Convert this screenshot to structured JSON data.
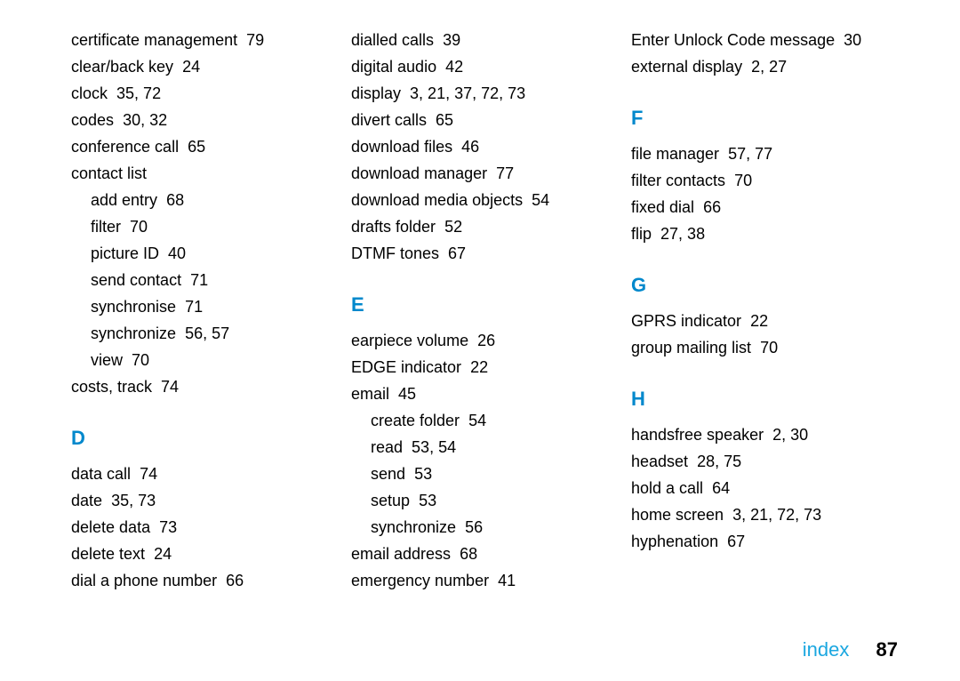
{
  "footer": {
    "label": "index",
    "page": "87"
  },
  "headings": {
    "D": "D",
    "E": "E",
    "F": "F",
    "G": "G",
    "H": "H"
  },
  "col1_top": [
    {
      "term": "certificate management",
      "pages": "79"
    },
    {
      "term": "clear/back key",
      "pages": "24"
    },
    {
      "term": "clock",
      "pages": "35, 72"
    },
    {
      "term": "codes",
      "pages": "30, 32"
    },
    {
      "term": "conference call",
      "pages": "65"
    },
    {
      "term": "contact list",
      "pages": ""
    },
    {
      "term": "add entry",
      "pages": "68",
      "sub": true
    },
    {
      "term": "filter",
      "pages": "70",
      "sub": true
    },
    {
      "term": "picture ID",
      "pages": "40",
      "sub": true
    },
    {
      "term": "send contact",
      "pages": "71",
      "sub": true
    },
    {
      "term": "synchronise",
      "pages": "71",
      "sub": true
    },
    {
      "term": "synchronize",
      "pages": "56, 57",
      "sub": true
    },
    {
      "term": "view",
      "pages": "70",
      "sub": true
    },
    {
      "term": "costs, track",
      "pages": "74"
    }
  ],
  "col1_D": [
    {
      "term": "data call",
      "pages": "74"
    },
    {
      "term": "date",
      "pages": "35, 73"
    },
    {
      "term": "delete data",
      "pages": "73"
    },
    {
      "term": "delete text",
      "pages": "24"
    },
    {
      "term": "dial a phone number",
      "pages": "66"
    }
  ],
  "col2_top": [
    {
      "term": "dialled calls",
      "pages": "39"
    },
    {
      "term": "digital audio",
      "pages": "42"
    },
    {
      "term": "display",
      "pages": "3, 21, 37, 72, 73"
    },
    {
      "term": "divert calls",
      "pages": "65"
    },
    {
      "term": "download files",
      "pages": "46"
    },
    {
      "term": "download manager",
      "pages": "77"
    },
    {
      "term": "download media objects",
      "pages": "54"
    },
    {
      "term": "drafts folder",
      "pages": "52"
    },
    {
      "term": "DTMF tones",
      "pages": "67"
    }
  ],
  "col2_E": [
    {
      "term": "earpiece volume",
      "pages": "26"
    },
    {
      "term": "EDGE indicator",
      "pages": "22"
    },
    {
      "term": "email",
      "pages": "45"
    },
    {
      "term": "create folder",
      "pages": "54",
      "sub": true
    },
    {
      "term": "read",
      "pages": "53, 54",
      "sub": true
    },
    {
      "term": "send",
      "pages": "53",
      "sub": true
    },
    {
      "term": "setup",
      "pages": "53",
      "sub": true
    },
    {
      "term": "synchronize",
      "pages": "56",
      "sub": true
    },
    {
      "term": "email address",
      "pages": "68"
    },
    {
      "term": "emergency number",
      "pages": "41"
    }
  ],
  "col3_top": [
    {
      "term": "Enter Unlock Code message",
      "pages": "30"
    },
    {
      "term": "external display",
      "pages": "2, 27"
    }
  ],
  "col3_F": [
    {
      "term": "file manager",
      "pages": "57, 77"
    },
    {
      "term": "filter contacts",
      "pages": "70"
    },
    {
      "term": "fixed dial",
      "pages": "66"
    },
    {
      "term": "flip",
      "pages": "27, 38"
    }
  ],
  "col3_G": [
    {
      "term": "GPRS indicator",
      "pages": "22"
    },
    {
      "term": "group mailing list",
      "pages": "70"
    }
  ],
  "col3_H": [
    {
      "term": "handsfree speaker",
      "pages": "2, 30"
    },
    {
      "term": "headset",
      "pages": "28, 75"
    },
    {
      "term": "hold a call",
      "pages": "64"
    },
    {
      "term": "home screen",
      "pages": "3, 21, 72, 73"
    },
    {
      "term": "hyphenation",
      "pages": "67"
    }
  ]
}
